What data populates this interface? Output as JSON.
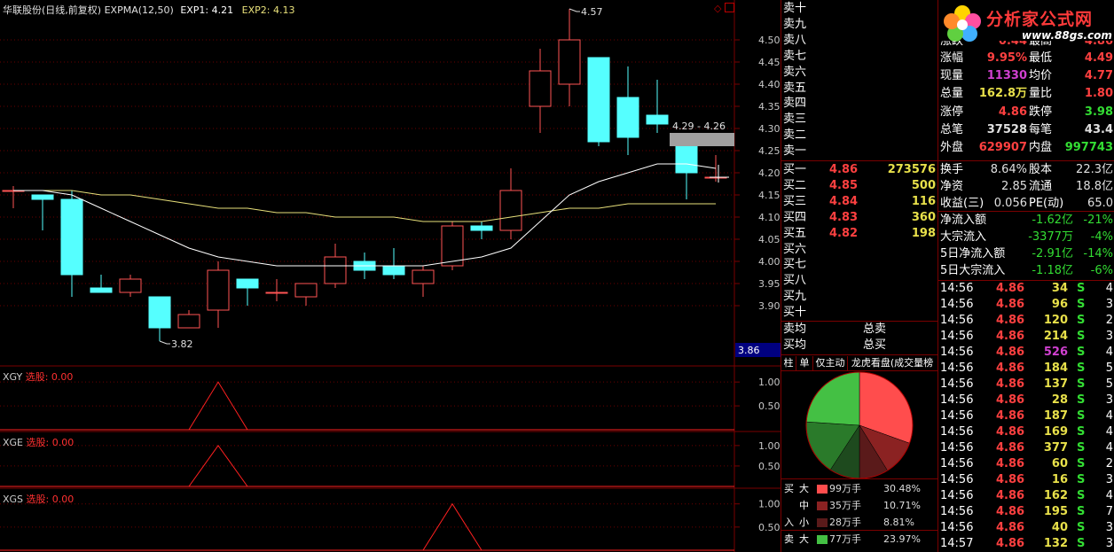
{
  "header": {
    "stock": "华联股份(日线,前复权)",
    "indicator": "EXPMA(12,50)",
    "exp1_label": "EXP1:",
    "exp1_value": "4.21",
    "exp2_label": "EXP2:",
    "exp2_value": "4.13"
  },
  "logo": {
    "title": "分析家公式网",
    "url": "www.88gs.com"
  },
  "chart_data": [
    {
      "type": "candlestick",
      "ylim": [
        3.78,
        4.62
      ],
      "yticks": [
        "4.50",
        "4.45",
        "4.40",
        "4.35",
        "4.30",
        "4.25",
        "4.20",
        "4.15",
        "4.10",
        "4.05",
        "4.00",
        "3.95",
        "3.90"
      ],
      "current_price_label": "3.86",
      "annotations": {
        "high": "4.57",
        "low": "3.82",
        "range": "4.29 - 4.26"
      },
      "candles": [
        {
          "o": 4.16,
          "h": 4.17,
          "l": 4.12,
          "c": 4.16
        },
        {
          "o": 4.15,
          "h": 4.15,
          "l": 4.07,
          "c": 4.14
        },
        {
          "o": 4.14,
          "h": 4.16,
          "l": 3.92,
          "c": 3.97
        },
        {
          "o": 3.94,
          "h": 3.97,
          "l": 3.93,
          "c": 3.93
        },
        {
          "o": 3.93,
          "h": 3.97,
          "l": 3.92,
          "c": 3.96
        },
        {
          "o": 3.92,
          "h": 3.92,
          "l": 3.82,
          "c": 3.85
        },
        {
          "o": 3.85,
          "h": 3.89,
          "l": 3.85,
          "c": 3.88
        },
        {
          "o": 3.89,
          "h": 4.0,
          "l": 3.85,
          "c": 3.98
        },
        {
          "o": 3.96,
          "h": 3.96,
          "l": 3.9,
          "c": 3.94
        },
        {
          "o": 3.93,
          "h": 3.96,
          "l": 3.91,
          "c": 3.93
        },
        {
          "o": 3.92,
          "h": 3.95,
          "l": 3.9,
          "c": 3.95
        },
        {
          "o": 3.95,
          "h": 4.04,
          "l": 3.94,
          "c": 4.01
        },
        {
          "o": 4.0,
          "h": 4.02,
          "l": 3.96,
          "c": 3.98
        },
        {
          "o": 3.99,
          "h": 4.03,
          "l": 3.96,
          "c": 3.97
        },
        {
          "o": 3.95,
          "h": 3.99,
          "l": 3.92,
          "c": 3.98
        },
        {
          "o": 3.99,
          "h": 4.09,
          "l": 3.98,
          "c": 4.08
        },
        {
          "o": 4.08,
          "h": 4.09,
          "l": 4.05,
          "c": 4.07
        },
        {
          "o": 4.07,
          "h": 4.21,
          "l": 4.05,
          "c": 4.16
        },
        {
          "o": 4.35,
          "h": 4.48,
          "l": 4.29,
          "c": 4.43
        },
        {
          "o": 4.4,
          "h": 4.57,
          "l": 4.35,
          "c": 4.5
        },
        {
          "o": 4.46,
          "h": 4.46,
          "l": 4.26,
          "c": 4.27
        },
        {
          "o": 4.37,
          "h": 4.44,
          "l": 4.24,
          "c": 4.28
        },
        {
          "o": 4.33,
          "h": 4.41,
          "l": 4.29,
          "c": 4.31
        },
        {
          "o": 4.26,
          "h": 4.26,
          "l": 4.14,
          "c": 4.2
        },
        {
          "o": 4.19,
          "h": 4.24,
          "l": 4.18,
          "c": 4.19
        }
      ],
      "exp1": [
        4.16,
        4.16,
        4.15,
        4.12,
        4.09,
        4.06,
        4.03,
        4.01,
        4.0,
        3.99,
        3.99,
        3.99,
        3.99,
        3.99,
        3.99,
        4.0,
        4.01,
        4.03,
        4.09,
        4.15,
        4.18,
        4.2,
        4.22,
        4.22,
        4.21
      ],
      "exp2": [
        4.16,
        4.16,
        4.16,
        4.15,
        4.15,
        4.14,
        4.13,
        4.12,
        4.12,
        4.11,
        4.11,
        4.1,
        4.1,
        4.1,
        4.09,
        4.09,
        4.09,
        4.1,
        4.11,
        4.12,
        4.12,
        4.13,
        4.13,
        4.13,
        4.13
      ]
    },
    {
      "type": "line",
      "name": "XGY",
      "label": "选股: 0.00",
      "yticks": [
        "1.00",
        "0.50"
      ],
      "ylim": [
        0,
        1.3
      ],
      "values": [
        0,
        0,
        0,
        0,
        0,
        0,
        0,
        1,
        0,
        0,
        0,
        0,
        0,
        0,
        0,
        0,
        0,
        0,
        0,
        0,
        0,
        0,
        0,
        0,
        0
      ]
    },
    {
      "type": "line",
      "name": "XGE",
      "label": "选股: 0.00",
      "yticks": [
        "1.00",
        "0.50"
      ],
      "ylim": [
        0,
        1.3
      ],
      "values": [
        0,
        0,
        0,
        0,
        0,
        0,
        0,
        1,
        0,
        0,
        0,
        0,
        0,
        0,
        0,
        0,
        0,
        0,
        0,
        0,
        0,
        0,
        0,
        0,
        0
      ]
    },
    {
      "type": "line",
      "name": "XGS",
      "label": "选股: 0.00",
      "yticks": [
        "1.00",
        "0.50"
      ],
      "ylim": [
        0,
        1.3
      ],
      "values": [
        0,
        0,
        0,
        0,
        0,
        0,
        0,
        0,
        0,
        0,
        0,
        0,
        0,
        0,
        0,
        1,
        0,
        0,
        0,
        0,
        0,
        0,
        0,
        0,
        0
      ]
    },
    {
      "type": "pie",
      "slices": [
        {
          "name": "买大",
          "value": 30.48,
          "color": "#ff4d4d"
        },
        {
          "name": "买中",
          "value": 10.71,
          "color": "#8b2222"
        },
        {
          "name": "买小",
          "value": 8.81,
          "color": "#5a1a1a"
        },
        {
          "name": "卖小",
          "value": 9.2,
          "color": "#1e4a1e"
        },
        {
          "name": "卖中",
          "value": 16.83,
          "color": "#2a7a2a"
        },
        {
          "name": "卖大",
          "value": 23.97,
          "color": "#44c044"
        }
      ]
    }
  ],
  "orderbook": {
    "sell": [
      "卖十",
      "卖九",
      "卖八",
      "卖七",
      "卖六",
      "卖五",
      "卖四",
      "卖三",
      "卖二",
      "卖一"
    ],
    "buy": [
      {
        "label": "买一",
        "price": "4.86",
        "vol": "273576"
      },
      {
        "label": "买二",
        "price": "4.85",
        "vol": "500"
      },
      {
        "label": "买三",
        "price": "4.84",
        "vol": "116"
      },
      {
        "label": "买四",
        "price": "4.83",
        "vol": "360"
      },
      {
        "label": "买五",
        "price": "4.82",
        "vol": "198"
      },
      {
        "label": "买六",
        "price": "",
        "vol": ""
      },
      {
        "label": "买七",
        "price": "",
        "vol": ""
      },
      {
        "label": "买八",
        "price": "",
        "vol": ""
      },
      {
        "label": "买九",
        "price": "",
        "vol": ""
      },
      {
        "label": "买十",
        "price": "",
        "vol": ""
      }
    ],
    "sell_avg": "卖均",
    "sell_total": "总卖",
    "buy_avg": "买均",
    "buy_total": "总买"
  },
  "tabs": [
    "柱",
    "单",
    "仅主动",
    "龙虎看盘(成交量榜"
  ],
  "legend": {
    "buy_label": "买",
    "in_label": "入",
    "sell_label": "卖",
    "rows": [
      {
        "size": "大",
        "amount": "99万手",
        "pct": "30.48%",
        "color": "#ff4d4d"
      },
      {
        "size": "中",
        "amount": "35万手",
        "pct": "10.71%",
        "color": "#8b2222"
      },
      {
        "size": "小",
        "amount": "28万手",
        "pct": "8.81%",
        "color": "#5a1a1a"
      },
      {
        "size": "大",
        "amount": "77万手",
        "pct": "23.97%",
        "color": "#44c044"
      }
    ]
  },
  "quote": {
    "partial_top": [
      {
        "l": "涨跌",
        "v": "0.44",
        "l2": "最高",
        "v2": "4.86"
      }
    ],
    "rows": [
      {
        "l": "涨幅",
        "v": "9.95%",
        "vc": "red",
        "l2": "最低",
        "v2": "4.49",
        "v2c": "red"
      },
      {
        "l": "现量",
        "v": "11330",
        "vc": "purple",
        "l2": "均价",
        "v2": "4.77",
        "v2c": "red"
      },
      {
        "l": "总量",
        "v": "162.8万",
        "vc": "yellow",
        "l2": "量比",
        "v2": "1.80",
        "v2c": "red"
      },
      {
        "l": "涨停",
        "v": "4.86",
        "vc": "red",
        "l2": "跌停",
        "v2": "3.98",
        "v2c": "green"
      },
      {
        "l": "总笔",
        "v": "37528",
        "vc": "white",
        "l2": "每笔",
        "v2": "43.4",
        "v2c": "white"
      },
      {
        "l": "外盘",
        "v": "629907",
        "vc": "red",
        "l2": "内盘",
        "v2": "997743",
        "v2c": "green"
      }
    ],
    "rows2": [
      {
        "l": "换手",
        "v": "8.64%",
        "vc": "white",
        "l2": "股本",
        "v2": "22.3亿",
        "v2c": "white"
      },
      {
        "l": "净资",
        "v": "2.85",
        "vc": "white",
        "l2": "流通",
        "v2": "18.8亿",
        "v2c": "white"
      },
      {
        "l": "收益(三)",
        "v": "0.056",
        "vc": "white",
        "l2": "PE(动)",
        "v2": "65.0",
        "v2c": "white"
      }
    ],
    "flows": [
      {
        "l": "净流入额",
        "v": "-1.62亿",
        "p": "-21%"
      },
      {
        "l": "大宗流入",
        "v": "-3377万",
        "p": "-4%"
      },
      {
        "l": "5日净流入额",
        "v": "-2.91亿",
        "p": "-14%"
      },
      {
        "l": "5日大宗流入",
        "v": "-1.18亿",
        "p": "-6%"
      }
    ]
  },
  "ticks": [
    {
      "t": "14:56",
      "p": "4.86",
      "v": "34",
      "vc": "yellow",
      "s": "S",
      "n": "4"
    },
    {
      "t": "14:56",
      "p": "4.86",
      "v": "96",
      "vc": "yellow",
      "s": "S",
      "n": "3"
    },
    {
      "t": "14:56",
      "p": "4.86",
      "v": "120",
      "vc": "yellow",
      "s": "S",
      "n": "2"
    },
    {
      "t": "14:56",
      "p": "4.86",
      "v": "214",
      "vc": "yellow",
      "s": "S",
      "n": "3"
    },
    {
      "t": "14:56",
      "p": "4.86",
      "v": "526",
      "vc": "purple",
      "s": "S",
      "n": "4"
    },
    {
      "t": "14:56",
      "p": "4.86",
      "v": "184",
      "vc": "yellow",
      "s": "S",
      "n": "5"
    },
    {
      "t": "14:56",
      "p": "4.86",
      "v": "137",
      "vc": "yellow",
      "s": "S",
      "n": "5"
    },
    {
      "t": "14:56",
      "p": "4.86",
      "v": "28",
      "vc": "yellow",
      "s": "S",
      "n": "3"
    },
    {
      "t": "14:56",
      "p": "4.86",
      "v": "187",
      "vc": "yellow",
      "s": "S",
      "n": "4"
    },
    {
      "t": "14:56",
      "p": "4.86",
      "v": "169",
      "vc": "yellow",
      "s": "S",
      "n": "4"
    },
    {
      "t": "14:56",
      "p": "4.86",
      "v": "377",
      "vc": "yellow",
      "s": "S",
      "n": "4"
    },
    {
      "t": "14:56",
      "p": "4.86",
      "v": "60",
      "vc": "yellow",
      "s": "S",
      "n": "2"
    },
    {
      "t": "14:56",
      "p": "4.86",
      "v": "16",
      "vc": "yellow",
      "s": "S",
      "n": "3"
    },
    {
      "t": "14:56",
      "p": "4.86",
      "v": "162",
      "vc": "yellow",
      "s": "S",
      "n": "4"
    },
    {
      "t": "14:56",
      "p": "4.86",
      "v": "195",
      "vc": "yellow",
      "s": "S",
      "n": "7"
    },
    {
      "t": "14:56",
      "p": "4.86",
      "v": "40",
      "vc": "yellow",
      "s": "S",
      "n": "3"
    },
    {
      "t": "14:57",
      "p": "4.86",
      "v": "132",
      "vc": "yellow",
      "s": "S",
      "n": "3"
    }
  ],
  "colors": {
    "up": "#ff5555",
    "down": "#55ffff",
    "exp1": "#ffffff",
    "exp2": "#e8e07a",
    "grid": "#7a0000",
    "axis": "#c8c8c8"
  }
}
